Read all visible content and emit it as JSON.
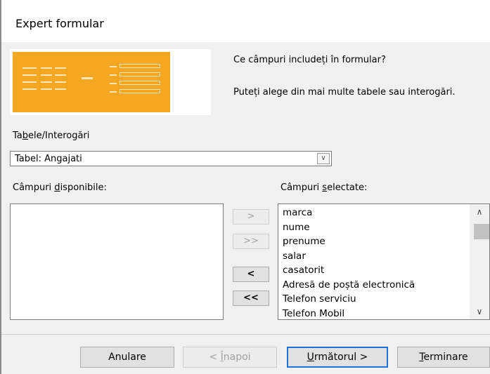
{
  "window": {
    "title": "Expert formular"
  },
  "wizard": {
    "question": "Ce câmpuri includeți în formular?",
    "hint": "Puteți alege din mai multe tabele sau interogări."
  },
  "tables": {
    "label_pre": "Ta",
    "label_ul": "b",
    "label_post": "ele/Interogări",
    "selected": "Tabel: Angajati"
  },
  "available_fields": {
    "label_pre": "Câmpuri ",
    "label_ul": "d",
    "label_post": "isponibile:",
    "items": []
  },
  "selected_fields": {
    "label_pre": "Câmpuri ",
    "label_ul": "s",
    "label_post": "electate:",
    "items": [
      "marca",
      "nume",
      "prenume",
      "salar",
      "casatorit",
      "Adresă de poștă electronică",
      "Telefon serviciu",
      "Telefon Mobil"
    ]
  },
  "move_buttons": {
    "add_one": ">",
    "add_all": ">>",
    "remove_one": "<",
    "remove_all": "<<"
  },
  "footer": {
    "cancel": "Anulare",
    "back_pre": "< ",
    "back_ul": "Î",
    "back_post": "napoi",
    "next_ul": "U",
    "next_post": "rmătorul >",
    "finish_ul": "T",
    "finish_post": "erminare"
  },
  "colors": {
    "preview": "#f5a623",
    "focus": "#1a73d9"
  },
  "icons": {
    "dropdown": "chevron-down-icon",
    "scroll_up": "chevron-up-icon",
    "scroll_down": "chevron-down-icon"
  }
}
